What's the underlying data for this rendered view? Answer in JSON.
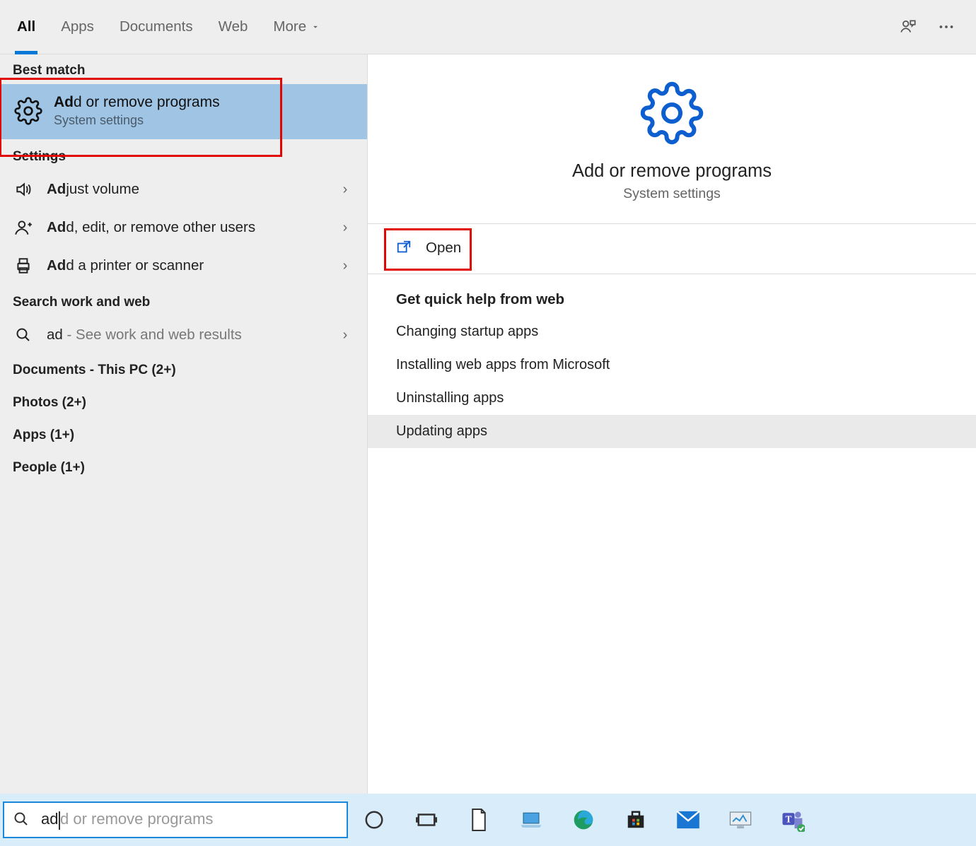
{
  "tabs": {
    "all": "All",
    "apps": "Apps",
    "documents": "Documents",
    "web": "Web",
    "more": "More"
  },
  "left": {
    "best_match_label": "Best match",
    "best_match": {
      "title_bold": "Ad",
      "title_rest": "d or remove programs",
      "subtitle": "System settings"
    },
    "settings_label": "Settings",
    "settings_items": [
      {
        "bold": "Ad",
        "rest": "just volume",
        "icon": "volume"
      },
      {
        "bold": "Ad",
        "rest": "d, edit, or remove other users",
        "icon": "user-plus"
      },
      {
        "bold": "Ad",
        "rest": "d a printer or scanner",
        "icon": "printer"
      }
    ],
    "search_web_label": "Search work and web",
    "search_web_item": {
      "query": "ad",
      "suffix": " - See work and web results"
    },
    "categories": [
      "Documents - This PC (2+)",
      "Photos (2+)",
      "Apps (1+)",
      "People (1+)"
    ]
  },
  "right": {
    "title": "Add or remove programs",
    "subtitle": "System settings",
    "open_label": "Open",
    "quick_help_title": "Get quick help from web",
    "quick_items": [
      "Changing startup apps",
      "Installing web apps from Microsoft",
      "Uninstalling apps",
      "Updating apps"
    ]
  },
  "search": {
    "typed": "ad",
    "ghost": "d or remove programs"
  },
  "annotation_boxes": 2,
  "colors": {
    "accent_blue": "#0078d7",
    "selection_blue": "#a0c4e4",
    "gear_blue": "#0d5ecf",
    "annotation_red": "#e10600"
  }
}
